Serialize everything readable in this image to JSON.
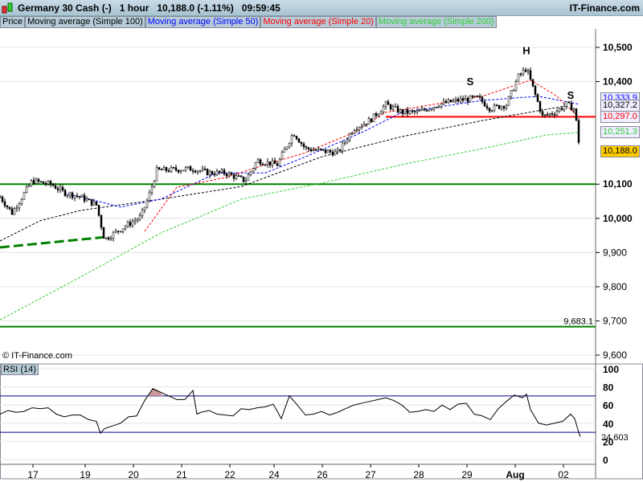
{
  "header": {
    "title": "Germany 30 Cash (-)   1 hour   10,188.0 (-1.11%)   09:59:45",
    "brand": "IT-Finance.com"
  },
  "legend": [
    {
      "label": "Price",
      "color": "#000000"
    },
    {
      "label": "Moving average (Simple 100)",
      "color": "#000000"
    },
    {
      "label": "Moving average (Simple 50)",
      "color": "#0000ff"
    },
    {
      "label": "Moving average (Simple 20)",
      "color": "#ff0000"
    },
    {
      "label": "Moving average (Simple 200)",
      "color": "#33cc33"
    }
  ],
  "copyright": "© IT-Finance.com",
  "rsi_label": "RSI (14)",
  "chart_data": {
    "type": "candlestick",
    "price_axis": {
      "ticks": [
        9600,
        9700,
        9800,
        9900,
        10000,
        10100,
        10400,
        10500
      ],
      "tick_labels": [
        "9,600",
        "9,700",
        "9,800",
        "9,900",
        "10,000",
        "10,100",
        "10,400",
        "10,500"
      ],
      "range": [
        9600,
        10550
      ]
    },
    "x_axis": {
      "labels": [
        "17",
        "19",
        "20",
        "21",
        "22",
        "24",
        "26",
        "27",
        "28",
        "29",
        "Aug",
        "02"
      ],
      "label_bars": [
        8,
        21,
        33,
        45,
        57,
        68,
        80,
        92,
        104,
        116,
        128,
        140
      ]
    },
    "price": [
      [
        0,
        10063
      ],
      [
        3,
        10016
      ],
      [
        8,
        10110
      ],
      [
        13,
        10098
      ],
      [
        16,
        10075
      ],
      [
        20,
        10063
      ],
      [
        24,
        10039
      ],
      [
        26,
        9938
      ],
      [
        30,
        9969
      ],
      [
        35,
        10004
      ],
      [
        37,
        10063
      ],
      [
        39,
        10140
      ],
      [
        48,
        10145
      ],
      [
        52,
        10133
      ],
      [
        56,
        10133
      ],
      [
        61,
        10110
      ],
      [
        64,
        10169
      ],
      [
        69,
        10157
      ],
      [
        73,
        10251
      ],
      [
        76,
        10204
      ],
      [
        80,
        10197
      ],
      [
        84,
        10192
      ],
      [
        88,
        10263
      ],
      [
        92,
        10286
      ],
      [
        96,
        10333
      ],
      [
        100,
        10310
      ],
      [
        104,
        10310
      ],
      [
        109,
        10333
      ],
      [
        114,
        10345
      ],
      [
        119,
        10352
      ],
      [
        122,
        10321
      ],
      [
        126,
        10333
      ],
      [
        129,
        10415
      ],
      [
        131,
        10439
      ],
      [
        133,
        10368
      ],
      [
        135,
        10298
      ],
      [
        138,
        10310
      ],
      [
        141,
        10333
      ],
      [
        143,
        10320
      ],
      [
        144.4,
        10188
      ]
    ],
    "ma200": [
      [
        0,
        9703
      ],
      [
        20,
        9828
      ],
      [
        40,
        9957
      ],
      [
        60,
        10056
      ],
      [
        80,
        10103
      ],
      [
        100,
        10157
      ],
      [
        120,
        10204
      ],
      [
        136,
        10244
      ],
      [
        144,
        10251.3
      ]
    ],
    "ma100": [
      [
        0,
        9934
      ],
      [
        10,
        9993
      ],
      [
        20,
        10023
      ],
      [
        40,
        10056
      ],
      [
        60,
        10093
      ],
      [
        80,
        10180
      ],
      [
        100,
        10239
      ],
      [
        120,
        10286
      ],
      [
        140,
        10327.2
      ]
    ],
    "ma50": [
      [
        16,
        10075
      ],
      [
        30,
        10033
      ],
      [
        40,
        10056
      ],
      [
        54,
        10133
      ],
      [
        66,
        10133
      ],
      [
        76,
        10180
      ],
      [
        90,
        10251
      ],
      [
        100,
        10310
      ],
      [
        120,
        10345
      ],
      [
        134,
        10357
      ],
      [
        144,
        10333.9
      ]
    ],
    "ma20": [
      [
        36,
        9962
      ],
      [
        44,
        10091
      ],
      [
        56,
        10119
      ],
      [
        66,
        10157
      ],
      [
        76,
        10192
      ],
      [
        88,
        10251
      ],
      [
        96,
        10310
      ],
      [
        120,
        10357
      ],
      [
        132,
        10404
      ],
      [
        138,
        10362
      ],
      [
        144,
        10297.0
      ]
    ],
    "trendline": [
      [
        0,
        9915
      ],
      [
        26,
        9945
      ]
    ],
    "levels": [
      {
        "price": 10100,
        "color": "#008000"
      },
      {
        "price": 9683.1,
        "color": "#008000",
        "label": "9,683.1"
      },
      {
        "price": 10297,
        "color": "#ff0000",
        "from_bar": 96
      }
    ],
    "annotations": [
      {
        "text": "H",
        "bar": 131,
        "price": 10480
      },
      {
        "text": "S",
        "bar": 117,
        "price": 10390
      },
      {
        "text": "S",
        "bar": 142,
        "price": 10350
      }
    ],
    "last_values": [
      {
        "label": "10,333.9",
        "color": "#0000ff"
      },
      {
        "label": "10,327.2",
        "color": "#000000"
      },
      {
        "label": "10,297.0",
        "color": "#ff0000"
      },
      {
        "label": "10,251.3",
        "color": "#33cc33"
      },
      {
        "label": "10,188.0",
        "color": "#000000",
        "bg": "#ffcc00"
      }
    ],
    "rsi": {
      "period": 14,
      "ticks": [
        0,
        20,
        40,
        60,
        80,
        100
      ],
      "levels": [
        30,
        70
      ],
      "last": "24.603",
      "values": [
        [
          0,
          50
        ],
        [
          2,
          54
        ],
        [
          4,
          52
        ],
        [
          6,
          53
        ],
        [
          8,
          57
        ],
        [
          10,
          56
        ],
        [
          12,
          57
        ],
        [
          14,
          50
        ],
        [
          16,
          47
        ],
        [
          18,
          49
        ],
        [
          20,
          49
        ],
        [
          22,
          44
        ],
        [
          24,
          42
        ],
        [
          25,
          29
        ],
        [
          26,
          34
        ],
        [
          28,
          37
        ],
        [
          30,
          40
        ],
        [
          32,
          47
        ],
        [
          34,
          48
        ],
        [
          36,
          65
        ],
        [
          38,
          78
        ],
        [
          40,
          74
        ],
        [
          42,
          70
        ],
        [
          44,
          66
        ],
        [
          46,
          66
        ],
        [
          48,
          76
        ],
        [
          49,
          50
        ],
        [
          50,
          52
        ],
        [
          52,
          54
        ],
        [
          54,
          50
        ],
        [
          56,
          49
        ],
        [
          58,
          48
        ],
        [
          60,
          56
        ],
        [
          62,
          55
        ],
        [
          64,
          57
        ],
        [
          66,
          58
        ],
        [
          68,
          61
        ],
        [
          70,
          45
        ],
        [
          72,
          70
        ],
        [
          74,
          60
        ],
        [
          76,
          49
        ],
        [
          78,
          50
        ],
        [
          80,
          53
        ],
        [
          82,
          49
        ],
        [
          84,
          52
        ],
        [
          86,
          56
        ],
        [
          88,
          60
        ],
        [
          90,
          62
        ],
        [
          92,
          64
        ],
        [
          94,
          66
        ],
        [
          96,
          68
        ],
        [
          98,
          65
        ],
        [
          100,
          60
        ],
        [
          102,
          52
        ],
        [
          104,
          53
        ],
        [
          106,
          55
        ],
        [
          108,
          53
        ],
        [
          110,
          60
        ],
        [
          112,
          55
        ],
        [
          114,
          61
        ],
        [
          116,
          62
        ],
        [
          118,
          50
        ],
        [
          120,
          48
        ],
        [
          122,
          44
        ],
        [
          124,
          56
        ],
        [
          126,
          64
        ],
        [
          128,
          71
        ],
        [
          130,
          68
        ],
        [
          131,
          72
        ],
        [
          132,
          55
        ],
        [
          134,
          40
        ],
        [
          136,
          38
        ],
        [
          138,
          40
        ],
        [
          140,
          42
        ],
        [
          142,
          50
        ],
        [
          143,
          45
        ],
        [
          144,
          30
        ],
        [
          144.4,
          25
        ]
      ]
    }
  }
}
